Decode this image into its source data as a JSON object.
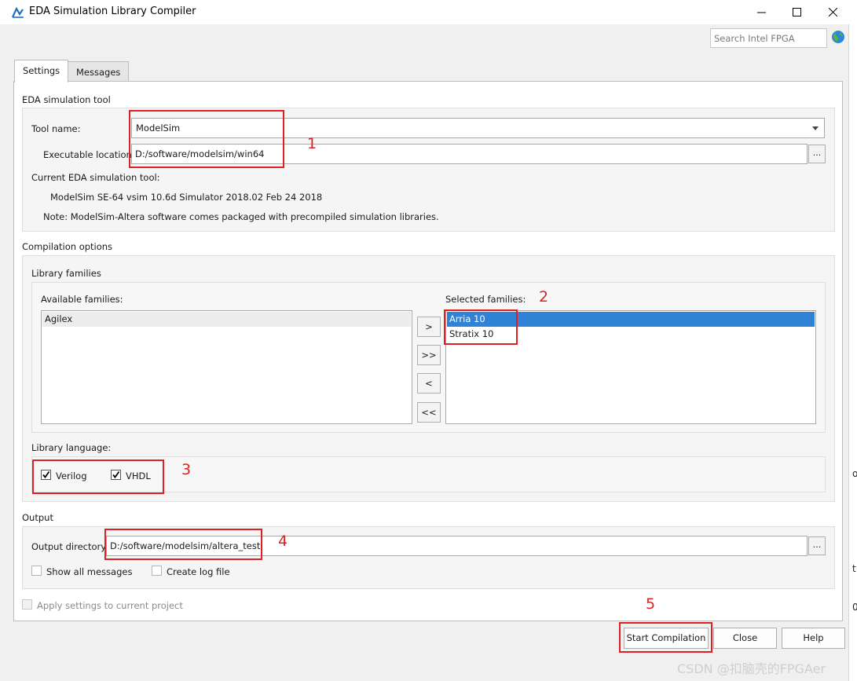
{
  "window": {
    "title": "EDA Simulation Library Compiler",
    "icons": [
      "app-icon",
      "minimize-icon",
      "maximize-icon",
      "close-icon"
    ]
  },
  "search": {
    "placeholder": "Search Intel FPGA",
    "icon": "globe-icon"
  },
  "tabs": [
    {
      "label": "Settings",
      "active": true
    },
    {
      "label": "Messages",
      "active": false
    }
  ],
  "eda_tool": {
    "section": "EDA simulation tool",
    "tool_name_label": "Tool name:",
    "tool_name_value": "ModelSim",
    "exe_label": "Executable location:",
    "exe_value": "D:/software/modelsim/win64",
    "browse_label": "...",
    "current_label": "Current EDA simulation tool:",
    "current_value": "ModelSim SE-64 vsim 10.6d Simulator 2018.02 Feb 24 2018",
    "note": "Note: ModelSim-Altera software comes packaged with precompiled simulation libraries."
  },
  "compilation": {
    "section": "Compilation options",
    "families_label": "Library families",
    "available_label": "Available families:",
    "available": [
      "Agilex"
    ],
    "selected_label": "Selected families:",
    "selected": [
      {
        "name": "Arria 10",
        "selected": true
      },
      {
        "name": "Stratix 10",
        "selected": false
      }
    ],
    "move_buttons": [
      ">",
      ">>",
      "<",
      "<<"
    ],
    "language_label": "Library language:",
    "languages": [
      {
        "label": "Verilog",
        "checked": true
      },
      {
        "label": "VHDL",
        "checked": true
      }
    ]
  },
  "output": {
    "section": "Output",
    "dir_label": "Output directory:",
    "dir_value": "D:/software/modelsim/altera_test",
    "browse_label": "...",
    "show_all": {
      "label": "Show all messages",
      "checked": false
    },
    "create_log": {
      "label": "Create log file",
      "checked": false
    }
  },
  "apply_settings": {
    "label": "Apply settings to current project",
    "checked": false,
    "enabled": false
  },
  "buttons": {
    "start": "Start Compilation",
    "close": "Close",
    "help": "Help"
  },
  "annotations": [
    "1",
    "2",
    "3",
    "4",
    "5"
  ],
  "annotation_color": "#e02020",
  "selection_color": "#2f82d6",
  "watermark": "CSDN @扣脑壳的FPGAer",
  "right_edge_glyphs": [
    "o",
    "t",
    "0"
  ]
}
